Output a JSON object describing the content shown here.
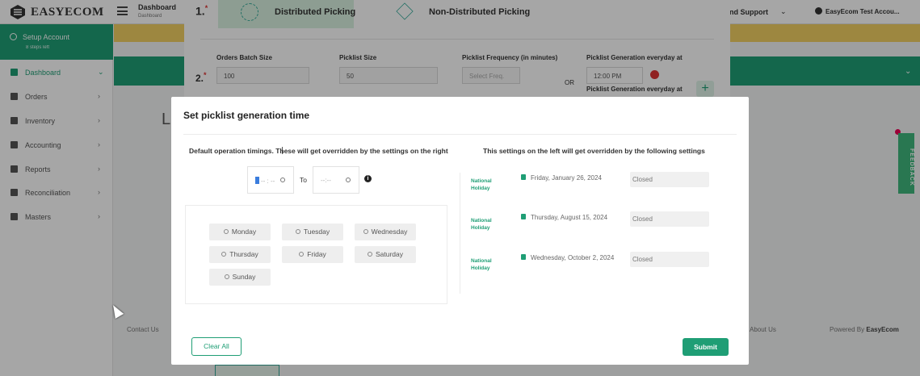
{
  "app": {
    "logo_text": "EASYECOM",
    "breadcrumb_title": "Dashboard",
    "breadcrumb_sub": "Dashboard",
    "support_label": "nd Support",
    "account_label": "EasyEcom Test Accou..."
  },
  "sidebar": {
    "setup_title": "Setup Account",
    "setup_sub": "8 steps left",
    "items": [
      {
        "label": "Dashboard",
        "icon": "dashboard-icon",
        "active": true
      },
      {
        "label": "Orders",
        "icon": "orders-icon"
      },
      {
        "label": "Inventory",
        "icon": "inventory-icon"
      },
      {
        "label": "Accounting",
        "icon": "accounting-icon"
      },
      {
        "label": "Reports",
        "icon": "reports-icon"
      },
      {
        "label": "Reconciliation",
        "icon": "reconciliation-icon"
      },
      {
        "label": "Masters",
        "icon": "masters-icon"
      }
    ]
  },
  "background_form": {
    "step1_number": "1.",
    "step2_number": "2.",
    "required_mark": "*",
    "distributed_label": "Distributed Picking",
    "non_distributed_label": "Non-Distributed Picking",
    "orders_batch_label": "Orders Batch Size",
    "orders_batch_value": "100",
    "picklist_size_label": "Picklist Size",
    "picklist_size_value": "50",
    "frequency_label": "Picklist Frequency (in minutes)",
    "frequency_placeholder": "Select Freq.",
    "or_text": "OR",
    "generation_label": "Picklist Generation everyday at",
    "generation_time": "12:00 PM",
    "generation_label_2": "Picklist Generation everyday at",
    "big_letter": "L"
  },
  "footer": {
    "contact": "Contact Us",
    "about": "About Us",
    "powered_prefix": "Powered By ",
    "powered_brand": "EasyEcom"
  },
  "feedback_label": "FEEDBACK",
  "modal": {
    "title": "Set picklist generation time",
    "left_heading": "Default operation timings. These will get overridden by the settings on the right",
    "right_heading": "This settings on the left will get overridden by the following settings",
    "time_from": "-- : --",
    "time_to": "--:--",
    "to_label": "To",
    "days": [
      "Monday",
      "Tuesday",
      "Wednesday",
      "Thursday",
      "Friday",
      "Saturday",
      "Sunday"
    ],
    "holidays": [
      {
        "type": "National Holiday",
        "date": "Friday, January 26, 2024",
        "status": "Closed"
      },
      {
        "type": "National Holiday",
        "date": "Thursday, August 15, 2024",
        "status": "Closed"
      },
      {
        "type": "National Holiday",
        "date": "Wednesday, October 2, 2024",
        "status": "Closed"
      }
    ],
    "clear_label": "Clear All",
    "submit_label": "Submit"
  },
  "colors": {
    "brand_green": "#1f9e75",
    "banner_yellow": "#f2cf63",
    "danger_red": "#dd3333"
  }
}
